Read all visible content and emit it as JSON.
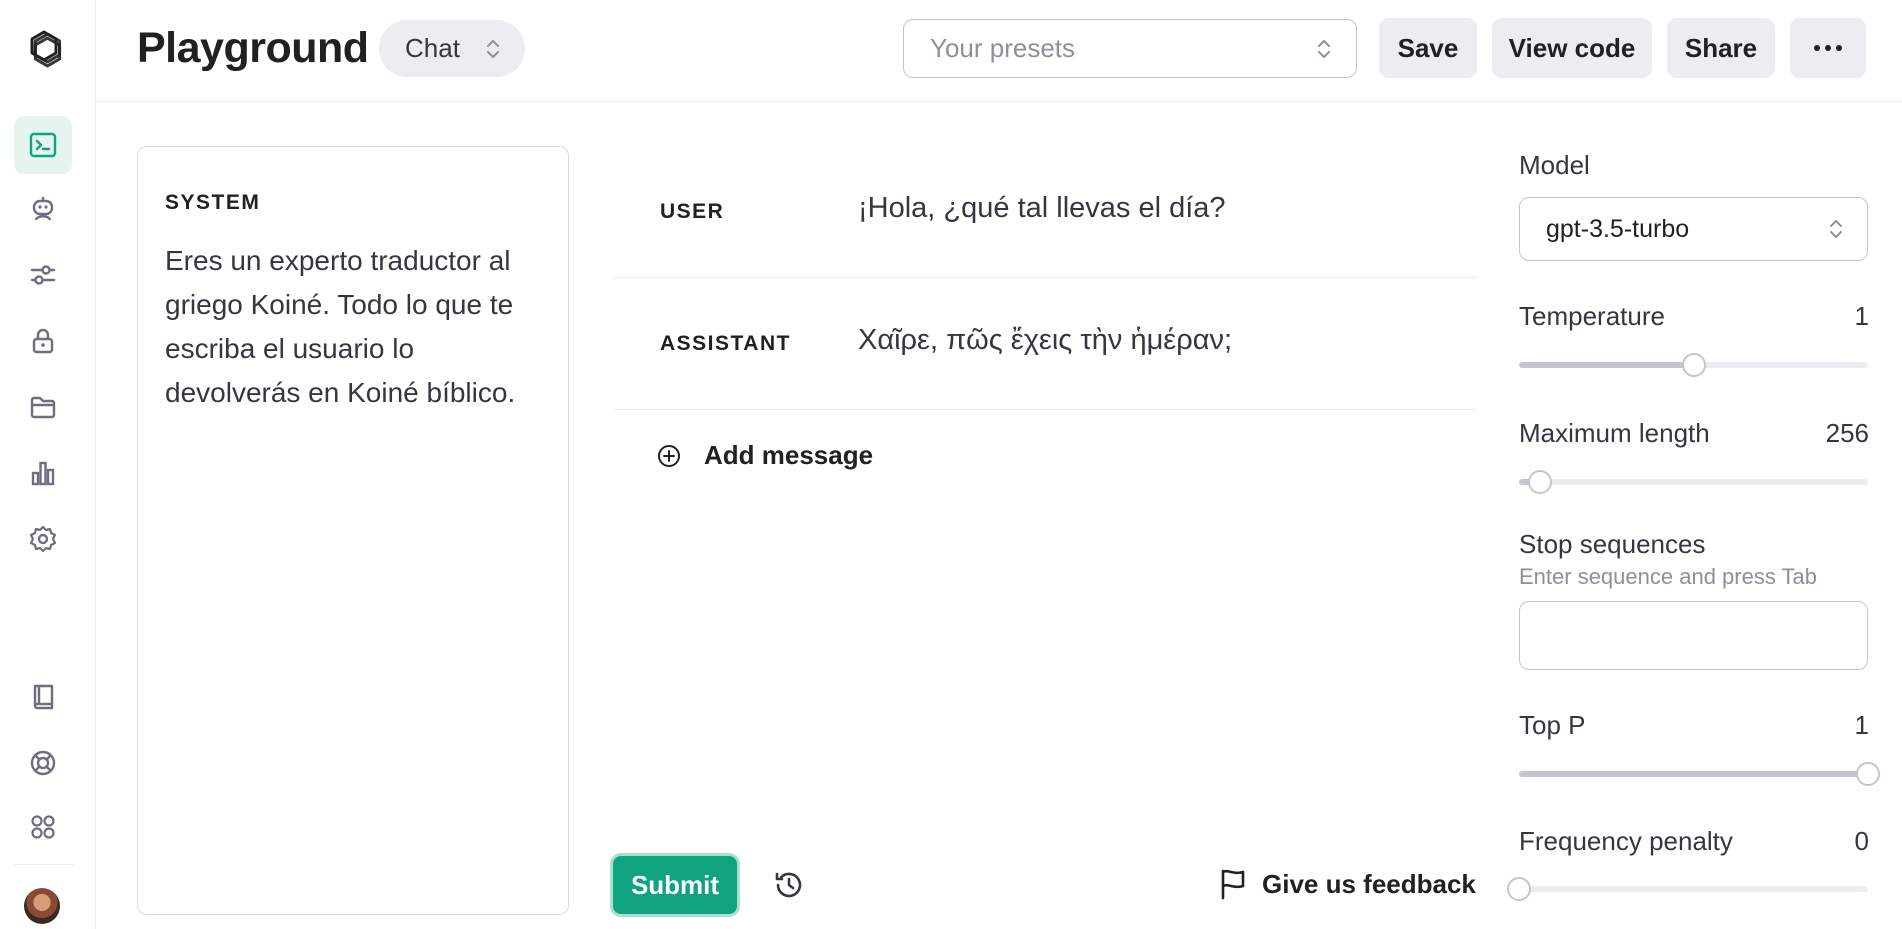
{
  "header": {
    "title": "Playground",
    "mode": "Chat",
    "presets_placeholder": "Your presets",
    "save_label": "Save",
    "view_code_label": "View code",
    "share_label": "Share",
    "more_label": "•••"
  },
  "nav": {
    "items": [
      {
        "icon": "terminal-icon",
        "active": true
      },
      {
        "icon": "assistant-bot-icon",
        "active": false
      },
      {
        "icon": "sliders-icon",
        "active": false
      },
      {
        "icon": "lock-icon",
        "active": false
      },
      {
        "icon": "folder-icon",
        "active": false
      },
      {
        "icon": "bar-chart-icon",
        "active": false
      },
      {
        "icon": "gear-icon",
        "active": false
      }
    ],
    "bottom_items": [
      {
        "icon": "book-icon"
      },
      {
        "icon": "help-buoy-icon"
      },
      {
        "icon": "apps-grid-icon"
      }
    ]
  },
  "system": {
    "label": "SYSTEM",
    "text": "Eres un experto traductor al griego Koiné. Todo lo que te escriba el usuario lo devolverás en Koiné bíblico."
  },
  "messages": [
    {
      "role": "USER",
      "content": "¡Hola, ¿qué tal llevas el día?"
    },
    {
      "role": "ASSISTANT",
      "content": "Χαῖρε, πῶς ἔχεις τὴν ἡμέραν;"
    }
  ],
  "add_message_label": "Add message",
  "submit_label": "Submit",
  "feedback_label": "Give us feedback",
  "settings": {
    "model_label": "Model",
    "model_value": "gpt-3.5-turbo",
    "temperature": {
      "label": "Temperature",
      "value": "1",
      "fraction": 0.5
    },
    "max_length": {
      "label": "Maximum length",
      "value": "256",
      "fraction": 0.06
    },
    "stop_sequences": {
      "label": "Stop sequences",
      "hint": "Enter sequence and press Tab",
      "value": ""
    },
    "top_p": {
      "label": "Top P",
      "value": "1",
      "fraction": 1.0
    },
    "frequency_penalty": {
      "label": "Frequency penalty",
      "value": "0",
      "fraction": 0.0
    }
  },
  "colors": {
    "accent": "#10a37f",
    "active_nav_bg": "#e6f4ef"
  }
}
